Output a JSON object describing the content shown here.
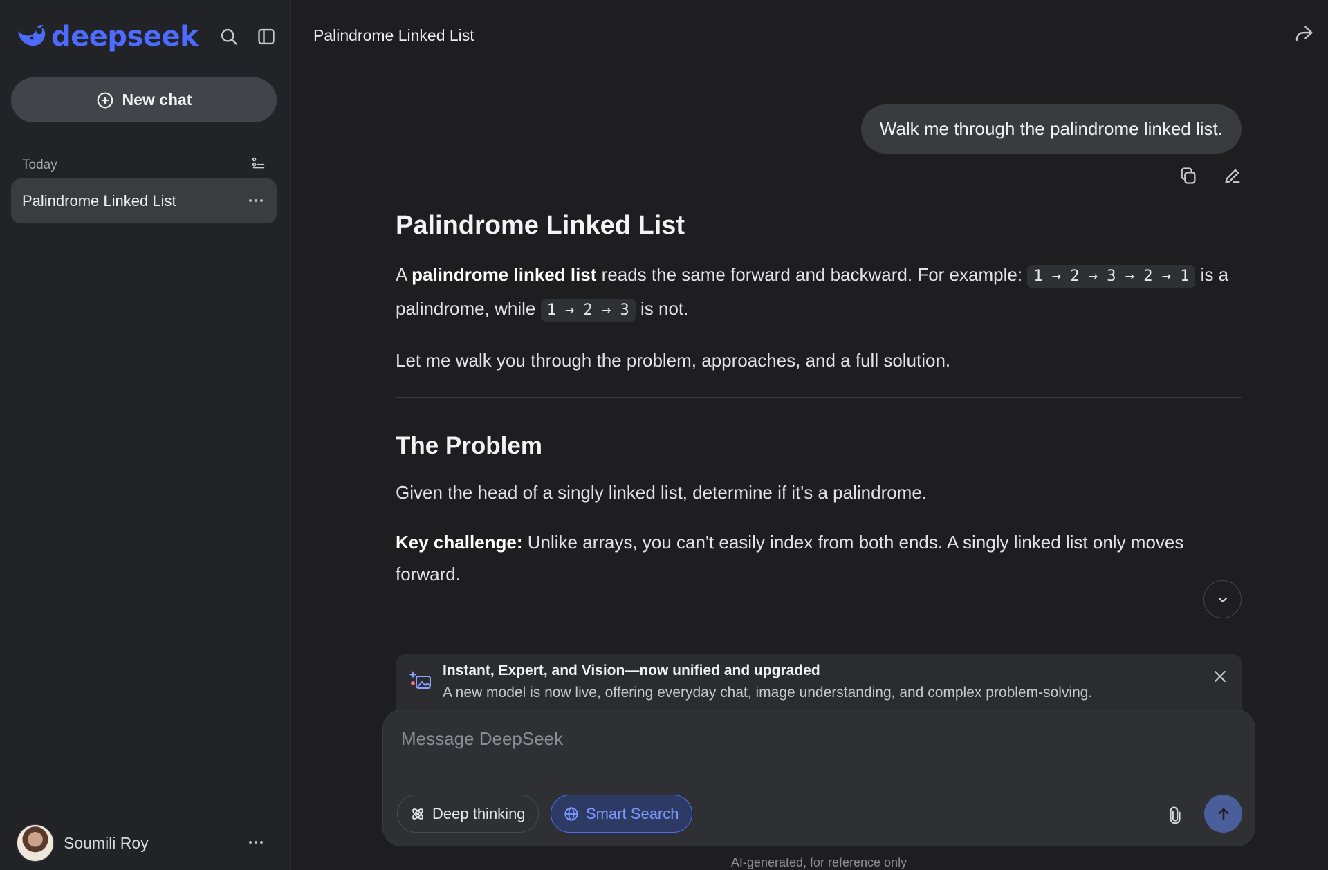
{
  "sidebar": {
    "logo_text": "deepseek",
    "new_chat_label": "New chat",
    "section_today": "Today",
    "history": [
      {
        "title": "Palindrome Linked List"
      }
    ],
    "user": {
      "name": "Soumili Roy"
    }
  },
  "header": {
    "title": "Palindrome Linked List"
  },
  "conversation": {
    "user_message": "Walk me through the palindrome linked list.",
    "response": {
      "heading": "Palindrome Linked List",
      "intro_prefix": "A ",
      "intro_bold": "palindrome linked list",
      "intro_middle": " reads the same forward and backward. For example: ",
      "example_palindrome": "1 → 2 → 3 → 2 → 1",
      "intro_continued": " is a palindrome, while ",
      "example_not": "1 → 2 → 3",
      "intro_suffix": " is not.",
      "walkthrough": "Let me walk you through the problem, approaches, and a full solution.",
      "problem_heading": "The Problem",
      "problem_text": "Given the head of a singly linked list, determine if it's a palindrome.",
      "challenge_label": "Key challenge:",
      "challenge_text": " Unlike arrays, you can't easily index from both ends. A singly linked list only moves forward."
    }
  },
  "notice": {
    "title": "Instant, Expert, and Vision—now unified and upgraded",
    "description": "A new model is now live, offering everyday chat, image understanding, and complex problem-solving."
  },
  "composer": {
    "placeholder": "Message DeepSeek",
    "deep_thinking_label": "Deep thinking",
    "smart_search_label": "Smart Search",
    "smart_search_active": true
  },
  "footer": {
    "disclaimer": "AI-generated, for reference only"
  },
  "colors": {
    "accent": "#4d6bfe",
    "background": "#1e1e20",
    "sidebar": "#212327"
  }
}
